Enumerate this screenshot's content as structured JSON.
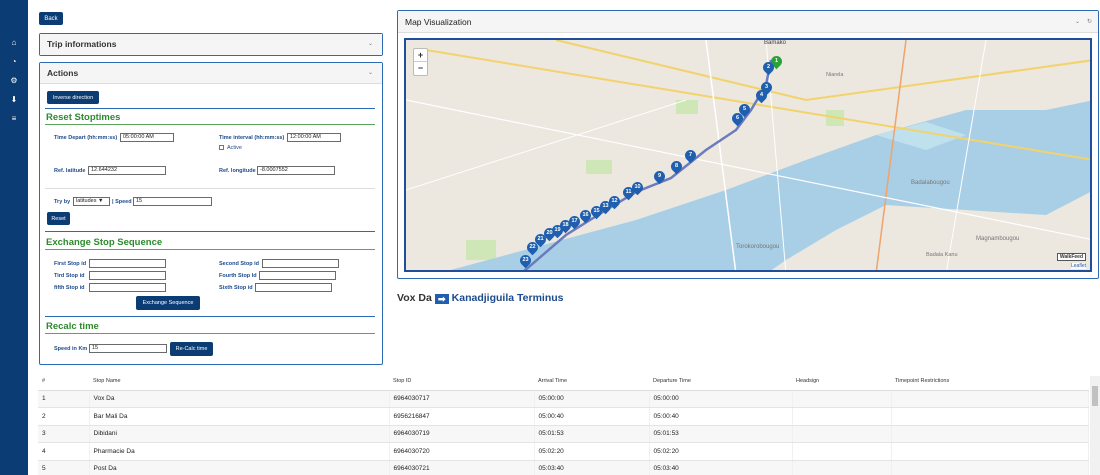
{
  "sidebar": {
    "icons": [
      "home-icon",
      "dashboard-icon",
      "settings-icon",
      "download-icon",
      "list-icon"
    ]
  },
  "back_label": "Back",
  "trip_panel": {
    "title": "Trip informations"
  },
  "actions_panel": {
    "title": "Actions",
    "inverse_label": "Inverse direction",
    "reset_stoptimes": {
      "title": "Reset Stoptimes",
      "time_depart_label": "Time Depart (hh:mm:ss)",
      "time_depart_value": "05:00:00 AM",
      "time_interval_label": "Time interval (hh:mm:ss)",
      "time_interval_value": "12:00:00 AM",
      "active_label": "Active",
      "ref_lat_label": "Ref. latitude",
      "ref_lat_value": "12.644232",
      "ref_lon_label": "Ref. longitude",
      "ref_lon_value": "-8.0007552",
      "try_by_label": "Try by",
      "try_by_value": "latitudes",
      "speed_label": "| Speed",
      "speed_value": "15",
      "reset_label": "Reset"
    },
    "exchange": {
      "title": "Exchange Stop Sequence",
      "first_label": "First Stop id",
      "second_label": "Second Stop id",
      "third_label": "Tird Stop id",
      "fourth_label": "Fourth Stop Id",
      "fifth_label": "fifth Stop id",
      "sixth_label": "Sixth Stop id",
      "button_label": "Exchange Sequence"
    },
    "recalc": {
      "title": "Recalc time",
      "speed_label": "Speed in Km",
      "speed_value": "15",
      "button_label": "Re-Calc time"
    }
  },
  "map_panel": {
    "title": "Map Visualization",
    "zoom_in": "+",
    "zoom_out": "−",
    "city_labels": [
      "Bamako",
      "Niarela",
      "Badalabougou",
      "Torokorobougou",
      "Magnambougou",
      "Badala Kanu"
    ],
    "markers": [
      "1",
      "2",
      "3",
      "4",
      "5",
      "6",
      "7",
      "8",
      "9",
      "10",
      "11",
      "12",
      "13",
      "15",
      "16",
      "17",
      "18",
      "19",
      "20",
      "21",
      "22",
      "23"
    ],
    "attribution_box": "WalkFeed",
    "attribution_link": "Leaflet"
  },
  "route": {
    "from": "Vox Da",
    "to": "Kanadjiguila Terminus"
  },
  "table": {
    "headers": [
      "#",
      "Stop Name",
      "Stop ID",
      "Arrival Time",
      "Departure Time",
      "Headsign",
      "Timepoint Restrictions"
    ],
    "rows": [
      [
        "1",
        "Vox Da",
        "6964030717",
        "05:00:00",
        "05:00:00",
        "",
        ""
      ],
      [
        "2",
        "Bar Mali Da",
        "6956216847",
        "05:00:40",
        "05:00:40",
        "",
        ""
      ],
      [
        "3",
        "Dibidani",
        "6964030719",
        "05:01:53",
        "05:01:53",
        "",
        ""
      ],
      [
        "4",
        "Pharmacie Da",
        "6964030720",
        "05:02:20",
        "05:02:20",
        "",
        ""
      ],
      [
        "5",
        "Post Da",
        "6964030721",
        "05:03:40",
        "05:03:40",
        "",
        ""
      ]
    ]
  },
  "colors": {
    "primary": "#0b3c74",
    "section": "#2d8a2d",
    "border": "#2c6bb3",
    "marker": "#1f5fae",
    "marker_start": "#2aa13a"
  }
}
